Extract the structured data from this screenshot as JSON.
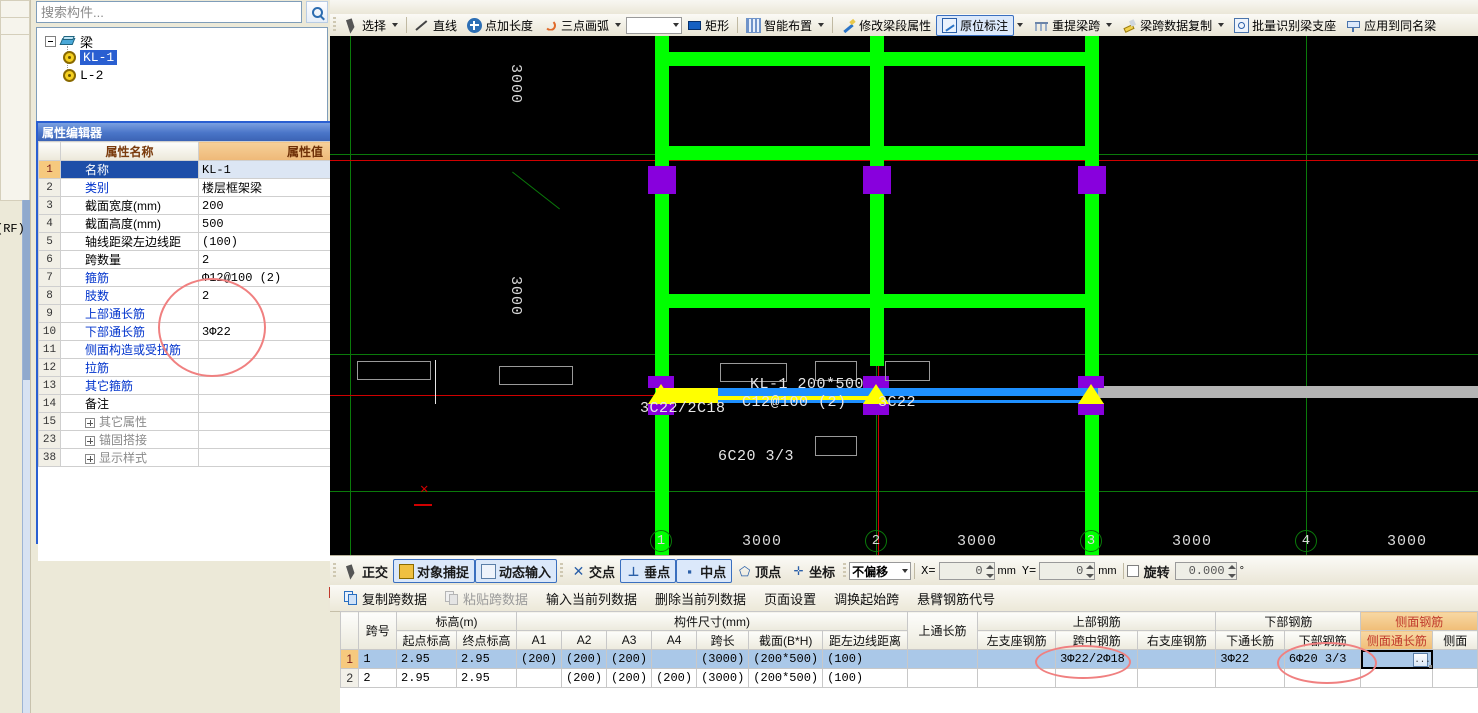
{
  "search": {
    "placeholder": "搜索构件...",
    "icon": "search-icon"
  },
  "tree": {
    "root": "梁",
    "items": [
      {
        "label": "KL-1",
        "selected": true
      },
      {
        "label": "L-2",
        "selected": false
      }
    ]
  },
  "left_strip": {
    "clipped_label": "(RF)"
  },
  "property_editor": {
    "title": "属性编辑器",
    "close": "×",
    "headers": {
      "index": "",
      "name": "属性名称",
      "value": "属性值"
    },
    "rows": [
      {
        "n": "1",
        "key": "名称",
        "value": "KL-1",
        "style": "selected"
      },
      {
        "n": "2",
        "key": "类别",
        "value": "楼层框架梁",
        "style": "link"
      },
      {
        "n": "3",
        "key": "截面宽度(mm)",
        "value": "200",
        "style": "plain"
      },
      {
        "n": "4",
        "key": "截面高度(mm)",
        "value": "500",
        "style": "plain"
      },
      {
        "n": "5",
        "key": "轴线距梁左边线距",
        "value": "(100)",
        "style": "plain"
      },
      {
        "n": "6",
        "key": "跨数量",
        "value": "2",
        "style": "plain"
      },
      {
        "n": "7",
        "key": "箍筋",
        "value": "Φ12@100 (2)",
        "style": "link"
      },
      {
        "n": "8",
        "key": "肢数",
        "value": "2",
        "style": "link"
      },
      {
        "n": "9",
        "key": "上部通长筋",
        "value": "",
        "style": "link"
      },
      {
        "n": "10",
        "key": "下部通长筋",
        "value": "3Φ22",
        "style": "link"
      },
      {
        "n": "11",
        "key": "侧面构造或受扭筋",
        "value": "",
        "style": "link"
      },
      {
        "n": "12",
        "key": "拉筋",
        "value": "",
        "style": "link"
      },
      {
        "n": "13",
        "key": "其它箍筋",
        "value": "",
        "style": "link"
      },
      {
        "n": "14",
        "key": "备注",
        "value": "",
        "style": "plain"
      },
      {
        "n": "15",
        "key": "其它属性",
        "value": "",
        "style": "group"
      },
      {
        "n": "23",
        "key": "锚固搭接",
        "value": "",
        "style": "group"
      },
      {
        "n": "38",
        "key": "显示样式",
        "value": "",
        "style": "group"
      }
    ]
  },
  "toolbar": {
    "items": [
      {
        "label": "选择",
        "icon": "cursor-arrow-icon",
        "dropdown": true,
        "active": false
      },
      {
        "label": "直线",
        "icon": "line-icon",
        "dropdown": false,
        "active": false
      },
      {
        "label": "点加长度",
        "icon": "point-length-icon",
        "dropdown": false,
        "active": false
      },
      {
        "label": "三点画弧",
        "icon": "three-point-arc-icon",
        "dropdown": true,
        "active": false
      },
      {
        "label": "矩形",
        "icon": "rectangle-icon",
        "dropdown": false,
        "active": false
      },
      {
        "label": "智能布置",
        "icon": "smart-layout-icon",
        "dropdown": true,
        "active": false
      },
      {
        "label": "修改梁段属性",
        "icon": "edit-beam-icon",
        "dropdown": false,
        "active": false
      },
      {
        "label": "原位标注",
        "icon": "in-situ-label-icon",
        "dropdown": true,
        "active": true
      },
      {
        "label": "重提梁跨",
        "icon": "re-extract-span-icon",
        "dropdown": true,
        "active": false
      },
      {
        "label": "梁跨数据复制",
        "icon": "copy-span-data-icon",
        "dropdown": true,
        "active": false
      },
      {
        "label": "批量识别梁支座",
        "icon": "batch-support-icon",
        "dropdown": false,
        "active": false
      },
      {
        "label": "应用到同名梁",
        "icon": "apply-same-name-icon",
        "dropdown": false,
        "active": false
      }
    ],
    "combo_value": ""
  },
  "canvas": {
    "beam_label_line1": "KL-1  200*500",
    "beam_label_line2": "C12@100 (2)",
    "left_support_rebar": "3C22/2C18",
    "mid_span_rebar": "3C22",
    "bottom_rebar": "6C20  3/3",
    "vertical_dims": [
      "3000",
      "3000"
    ],
    "horizontal_dims": [
      "3000",
      "3000",
      "3000",
      "3000"
    ],
    "axis_bubbles": [
      "1",
      "2",
      "3",
      "4"
    ],
    "colors": {
      "beam": "#00ff00",
      "column": "#8800dd",
      "axis": "#0a7a0a",
      "selected": "#ffff00",
      "highlight": "#1e90ff"
    }
  },
  "snapbar": {
    "items": [
      {
        "label": "正交",
        "icon": "ortho-icon",
        "on": false
      },
      {
        "label": "对象捕捉",
        "icon": "object-snap-icon",
        "on": true
      },
      {
        "label": "动态输入",
        "icon": "dynamic-input-icon",
        "on": true
      },
      {
        "label": "交点",
        "icon": "intersection-icon",
        "on": false
      },
      {
        "label": "垂点",
        "icon": "perpendicular-icon",
        "on": true
      },
      {
        "label": "中点",
        "icon": "midpoint-icon",
        "on": true
      },
      {
        "label": "顶点",
        "icon": "vertex-icon",
        "on": false
      },
      {
        "label": "坐标",
        "icon": "coordinate-icon",
        "on": false
      }
    ],
    "offset_mode": "不偏移",
    "x_label": "X=",
    "x_value": "0",
    "x_unit": "mm",
    "y_label": "Y=",
    "y_value": "0",
    "y_unit": "mm",
    "rotate_label": "旋转",
    "rotate_value": "0.000",
    "rotate_unit": "°"
  },
  "spanbar": {
    "items": [
      {
        "label": "复制跨数据",
        "icon": "copy-icon",
        "disabled": false
      },
      {
        "label": "粘贴跨数据",
        "icon": "paste-icon",
        "disabled": true
      },
      {
        "label": "输入当前列数据",
        "icon": "",
        "disabled": false
      },
      {
        "label": "删除当前列数据",
        "icon": "",
        "disabled": false
      },
      {
        "label": "页面设置",
        "icon": "",
        "disabled": false
      },
      {
        "label": "调换起始跨",
        "icon": "",
        "disabled": false
      },
      {
        "label": "悬臂钢筋代号",
        "icon": "",
        "disabled": false
      }
    ]
  },
  "grid": {
    "group_headers": [
      {
        "label": "",
        "span": 1
      },
      {
        "label": "跨号",
        "span": 1,
        "rowspan": 2
      },
      {
        "label": "标高(m)",
        "span": 2
      },
      {
        "label": "构件尺寸(mm)",
        "span": 7
      },
      {
        "label": "上通长筋",
        "span": 1,
        "rowspan": 2
      },
      {
        "label": "上部钢筋",
        "span": 3
      },
      {
        "label": "下部钢筋",
        "span": 2
      },
      {
        "label": "侧面钢筋",
        "span": 2,
        "accent": true
      }
    ],
    "sub_headers": [
      "起点标高",
      "终点标高",
      "A1",
      "A2",
      "A3",
      "A4",
      "跨长",
      "截面(B*H)",
      "距左边线距离",
      "左支座钢筋",
      "跨中钢筋",
      "右支座钢筋",
      "下通长筋",
      "下部钢筋",
      "侧面通长筋",
      "侧面"
    ],
    "rows": [
      {
        "rownum": "1",
        "selected": true,
        "cells": [
          "1",
          "2.95",
          "2.95",
          "(200)",
          "(200)",
          "(200)",
          "",
          "(3000)",
          "(200*500)",
          "(100)",
          "",
          "",
          "3Φ22/2Φ18",
          "",
          "3Φ22",
          "6Φ20 3/3",
          "",
          ""
        ]
      },
      {
        "rownum": "2",
        "selected": false,
        "cells": [
          "2",
          "2.95",
          "2.95",
          "",
          "(200)",
          "(200)",
          "(200)",
          "(3000)",
          "(200*500)",
          "(100)",
          "",
          "",
          "",
          "",
          "",
          "",
          "",
          ""
        ]
      }
    ],
    "edit_cell_button": "..."
  }
}
